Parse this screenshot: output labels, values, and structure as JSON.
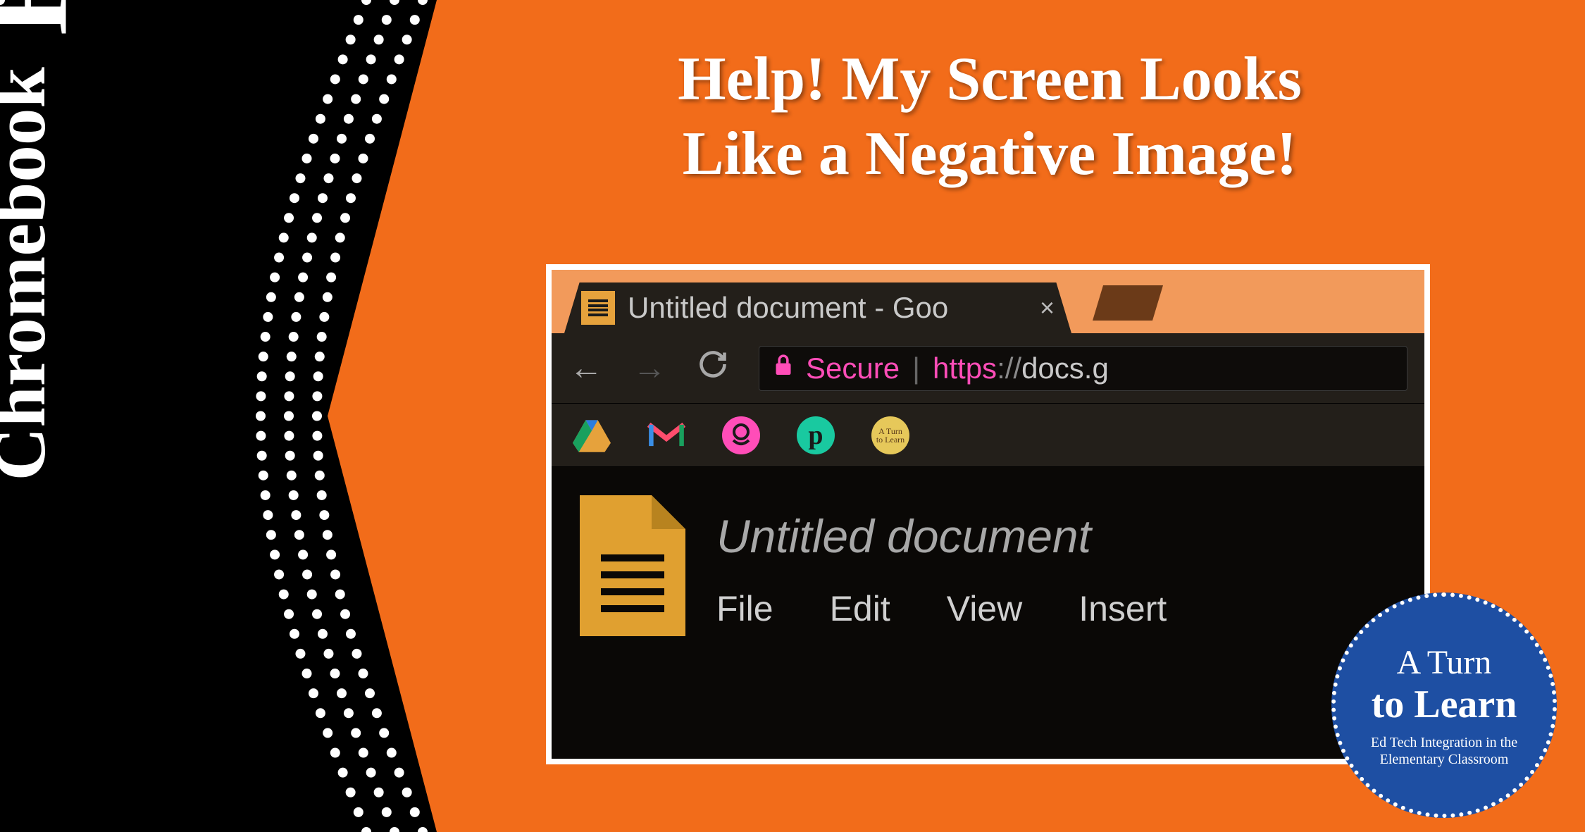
{
  "sidebar": {
    "title_part1": "Chromebook",
    "title_part2": "Help!"
  },
  "headline": {
    "line1": "Help! My Screen Looks",
    "line2": "Like a Negative Image!"
  },
  "browser": {
    "tab": {
      "title": "Untitled document - Goo",
      "close": "×"
    },
    "address": {
      "secure_label": "Secure",
      "separator": "|",
      "url_protocol": "https",
      "url_sep": "://",
      "url_host": "docs.g"
    },
    "bookmarks": [
      {
        "name": "drive-icon",
        "color": "#e6a23c"
      },
      {
        "name": "gmail-icon",
        "color": "#ff4d6d"
      },
      {
        "name": "pink-circle-icon",
        "color": "#ff4db8"
      },
      {
        "name": "pinterest-icon",
        "color": "#19c9a0"
      },
      {
        "name": "yellow-circle-icon",
        "color": "#e6c85a"
      }
    ],
    "document": {
      "title": "Untitled document",
      "menus": [
        "File",
        "Edit",
        "View",
        "Insert"
      ]
    }
  },
  "badge": {
    "line1": "A Turn",
    "line2": "to Learn",
    "subtitle": "Ed Tech Integration in the Elementary Classroom"
  }
}
